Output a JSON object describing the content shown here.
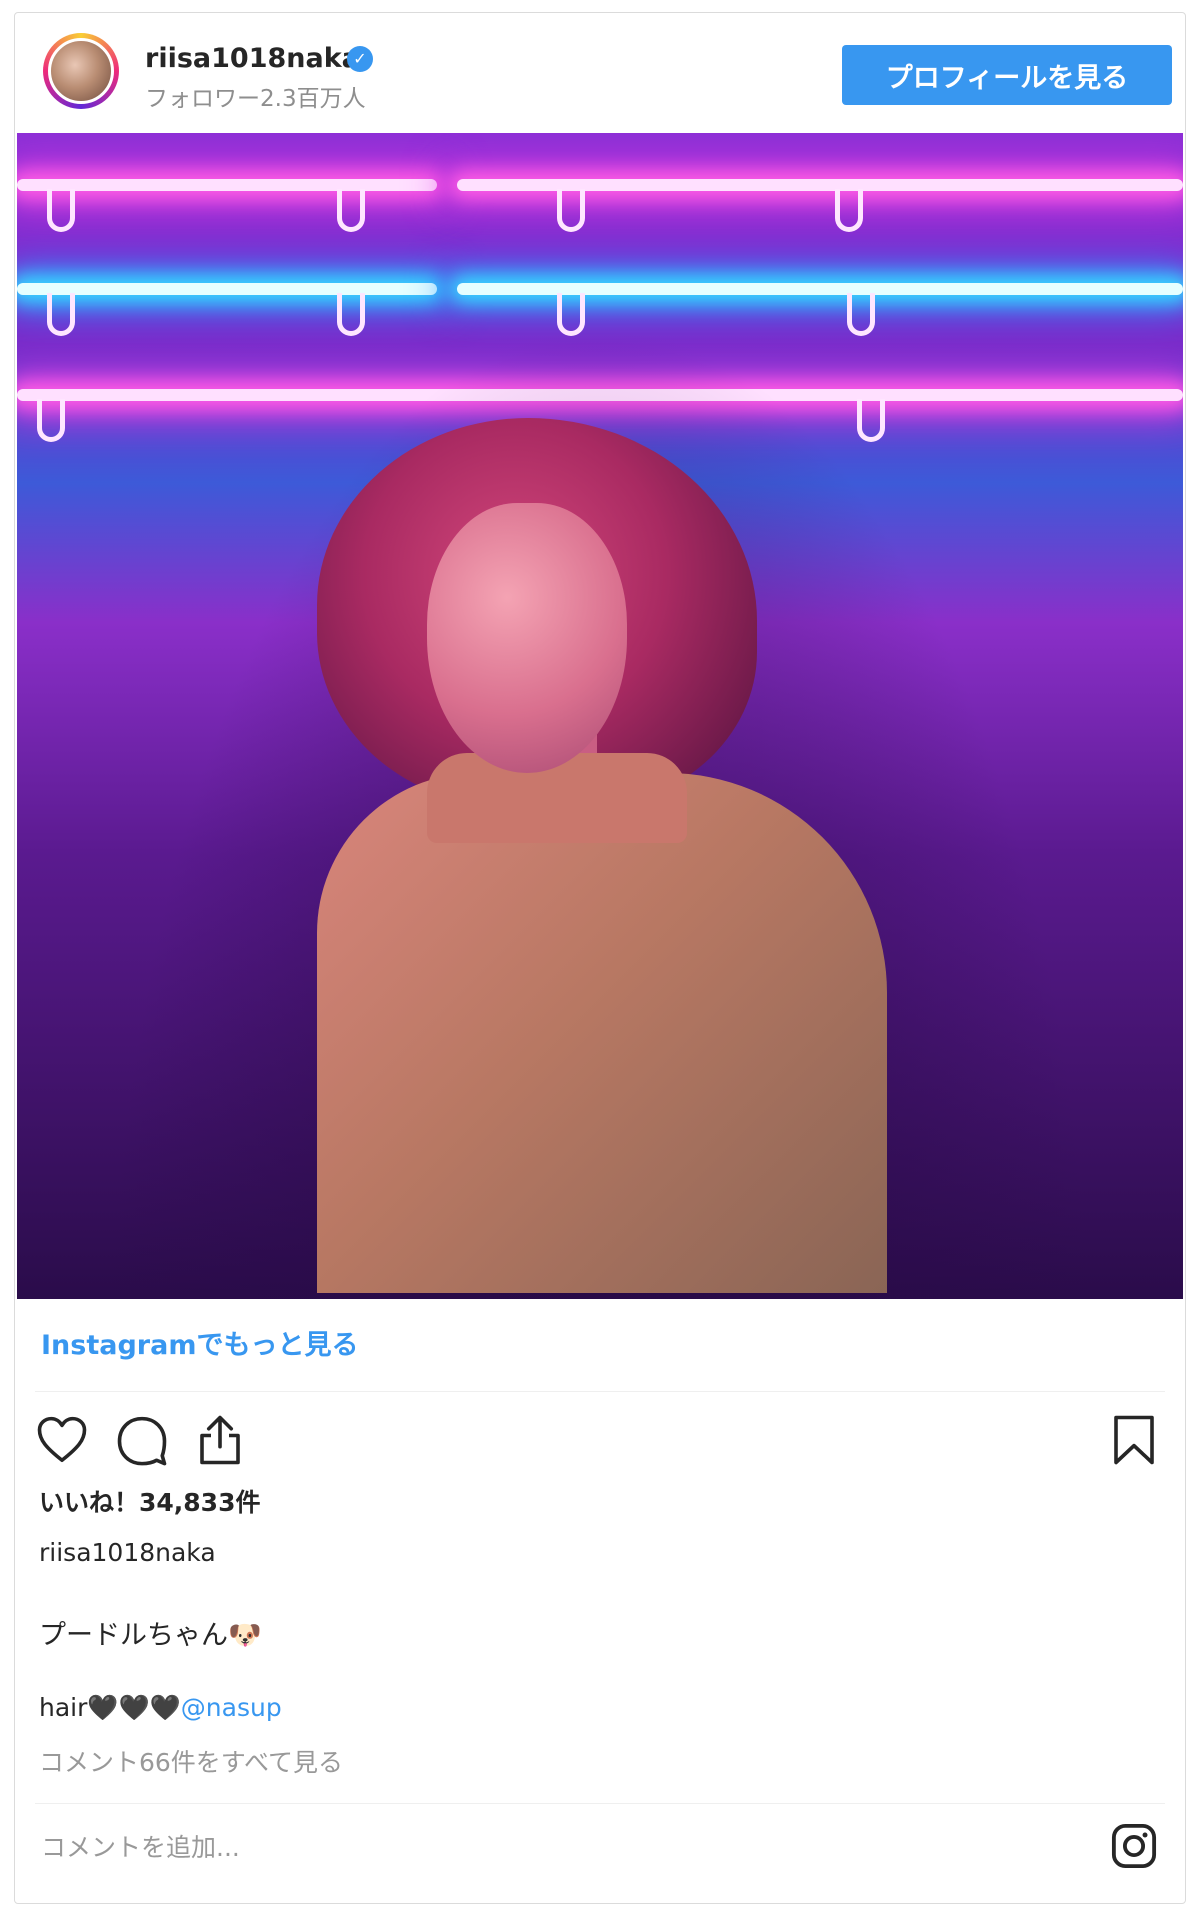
{
  "header": {
    "username": "riisa1018naka",
    "verified_icon": "verified-badge-icon",
    "followers": "フォロワー2.3百万人",
    "profile_button": "プロフィールを見る"
  },
  "post": {
    "more_link": "Instagramでもっと見る",
    "likes": "いいね！34,833件",
    "caption_user": "riisa1018naka",
    "caption_text": "プードルちゃん🐶",
    "caption_line_prefix": "hair🖤🖤🖤",
    "caption_mention": "@nasup",
    "view_comments": "コメント66件をすべて見る",
    "comment_placeholder": "コメントを追加..."
  },
  "icons": {
    "like": "heart-icon",
    "comment": "comment-icon",
    "share": "share-icon",
    "save": "bookmark-icon",
    "instagram": "instagram-logo-icon"
  },
  "colors": {
    "accent": "#3897f0",
    "muted": "#8e8e8e",
    "border": "#dbdbdb"
  }
}
